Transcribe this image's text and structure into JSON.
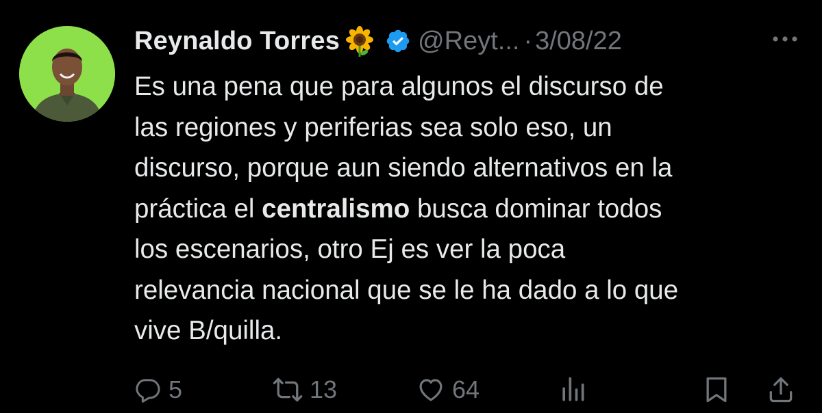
{
  "tweet": {
    "display_name": "Reynaldo Torres",
    "name_emoji": "sunflower",
    "verified": true,
    "handle": "@Reyt...",
    "separator": "·",
    "date": "3/08/22",
    "body": {
      "line1": "Es una pena que para algunos el discurso de",
      "line2": "las regiones y periferias sea solo eso, un",
      "line3": "discurso, porque aun siendo alternativos en la",
      "line4_pre": "práctica el ",
      "line4_bold": "centralismo",
      "line4_post": " busca dominar todos",
      "line5": "los escenarios, otro Ej es ver la poca",
      "line6": "relevancia nacional que se le ha dado a lo que",
      "line7": "vive B/quilla."
    },
    "stats": {
      "replies": "5",
      "retweets": "13",
      "likes": "64"
    },
    "colors": {
      "background": "#000000",
      "text": "#e7e9ea",
      "muted": "#71767b",
      "verified_blue": "#1d9bf0",
      "avatar_bg": "#8ee04a"
    },
    "icons": [
      "reply-icon",
      "retweet-icon",
      "like-icon",
      "views-icon",
      "bookmark-icon",
      "share-icon",
      "more-icon",
      "verified-badge-icon",
      "sunflower-emoji"
    ]
  }
}
